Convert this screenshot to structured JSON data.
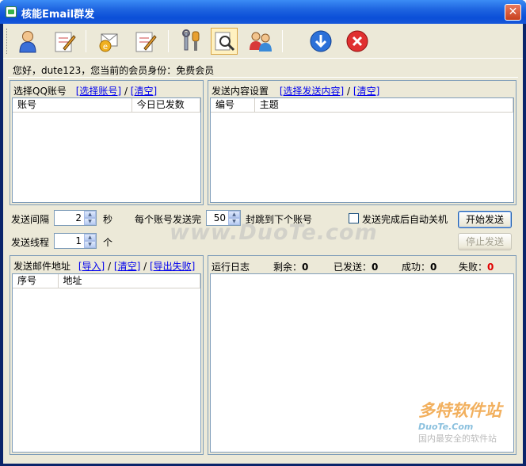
{
  "window": {
    "title": "核能Email群发"
  },
  "toolbar": {
    "buttons": [
      {
        "icon": "user-icon"
      },
      {
        "icon": "edit-icon"
      },
      {
        "icon": "email-icon"
      },
      {
        "icon": "compose-icon"
      },
      {
        "icon": "tools-icon"
      },
      {
        "icon": "search-icon"
      },
      {
        "icon": "users-icon"
      },
      {
        "icon": "download-icon"
      },
      {
        "icon": "exit-icon"
      }
    ]
  },
  "welcome": "您好，dute123，您当前的会员身份：免费会员",
  "qq_panel": {
    "label": "选择QQ账号",
    "select_link": "[选择账号]",
    "clear_link": "[清空]",
    "columns": [
      "账号",
      "今日已发数"
    ]
  },
  "content_panel": {
    "label": "发送内容设置",
    "select_link": "[选择发送内容]",
    "clear_link": "[清空]",
    "columns": [
      "编号",
      "主题"
    ]
  },
  "settings": {
    "interval_label": "发送间隔",
    "interval_value": "2",
    "interval_unit": "秒",
    "threads_label": "发送线程",
    "threads_value": "1",
    "threads_unit": "个",
    "per_account_label": "每个账号发送完",
    "per_account_value": "50",
    "per_account_suffix": "封跳到下个账号",
    "shutdown_label": "发送完成后自动关机",
    "shutdown_checked": false,
    "start_button": "开始发送",
    "stop_button": "停止发送"
  },
  "address_panel": {
    "label": "发送邮件地址",
    "import_link": "[导入]",
    "clear_link": "[清空]",
    "export_link": "[导出失败]",
    "columns": [
      "序号",
      "地址"
    ]
  },
  "log_panel": {
    "label": "运行日志",
    "remaining_label": "剩余：",
    "remaining_value": "0",
    "sent_label": "已发送：",
    "sent_value": "0",
    "success_label": "成功：",
    "success_value": "0",
    "fail_label": "失败：",
    "fail_value": "0"
  },
  "watermarks": {
    "center": "www.DuoTe.com",
    "corner_main": "多特软件站",
    "corner_sub": "DuoTe.Com",
    "corner_foot": "国内最安全的软件站"
  }
}
